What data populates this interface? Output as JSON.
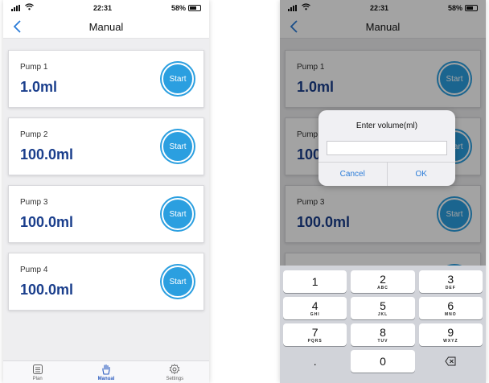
{
  "colors": {
    "accent": "#2b9fe0",
    "volume_text": "#1a3e8c",
    "active_tab": "#2a5bbf",
    "dialog_button": "#2b7cd8"
  },
  "status_bar": {
    "time": "22:31",
    "battery": "58%",
    "battery_level": 0.58
  },
  "nav": {
    "title": "Manual",
    "back_icon": "chevron-left-icon"
  },
  "pumps": [
    {
      "name": "Pump 1",
      "volume": "1.0ml",
      "button": "Start"
    },
    {
      "name": "Pump 2",
      "volume": "100.0ml",
      "button": "Start"
    },
    {
      "name": "Pump 3",
      "volume": "100.0ml",
      "button": "Start"
    },
    {
      "name": "Pump 4",
      "volume": "100.0ml",
      "button": "Start"
    }
  ],
  "tabs": [
    {
      "label": "Plan",
      "icon": "list-icon",
      "active": false
    },
    {
      "label": "Manual",
      "icon": "hand-icon",
      "active": true
    },
    {
      "label": "Settings",
      "icon": "gear-icon",
      "active": false
    }
  ],
  "dialog": {
    "title": "Enter volume(ml)",
    "input_value": "",
    "cancel": "Cancel",
    "ok": "OK"
  },
  "keypad": {
    "rows": [
      [
        {
          "num": "1",
          "letters": ""
        },
        {
          "num": "2",
          "letters": "ABC"
        },
        {
          "num": "3",
          "letters": "DEF"
        }
      ],
      [
        {
          "num": "4",
          "letters": "GHI"
        },
        {
          "num": "5",
          "letters": "JKL"
        },
        {
          "num": "6",
          "letters": "MNO"
        }
      ],
      [
        {
          "num": "7",
          "letters": "PQRS"
        },
        {
          "num": "8",
          "letters": "TUV"
        },
        {
          "num": "9",
          "letters": "WXYZ"
        }
      ]
    ],
    "bottom": {
      "left": ".",
      "middle": "0",
      "right_icon": "backspace-icon"
    }
  }
}
